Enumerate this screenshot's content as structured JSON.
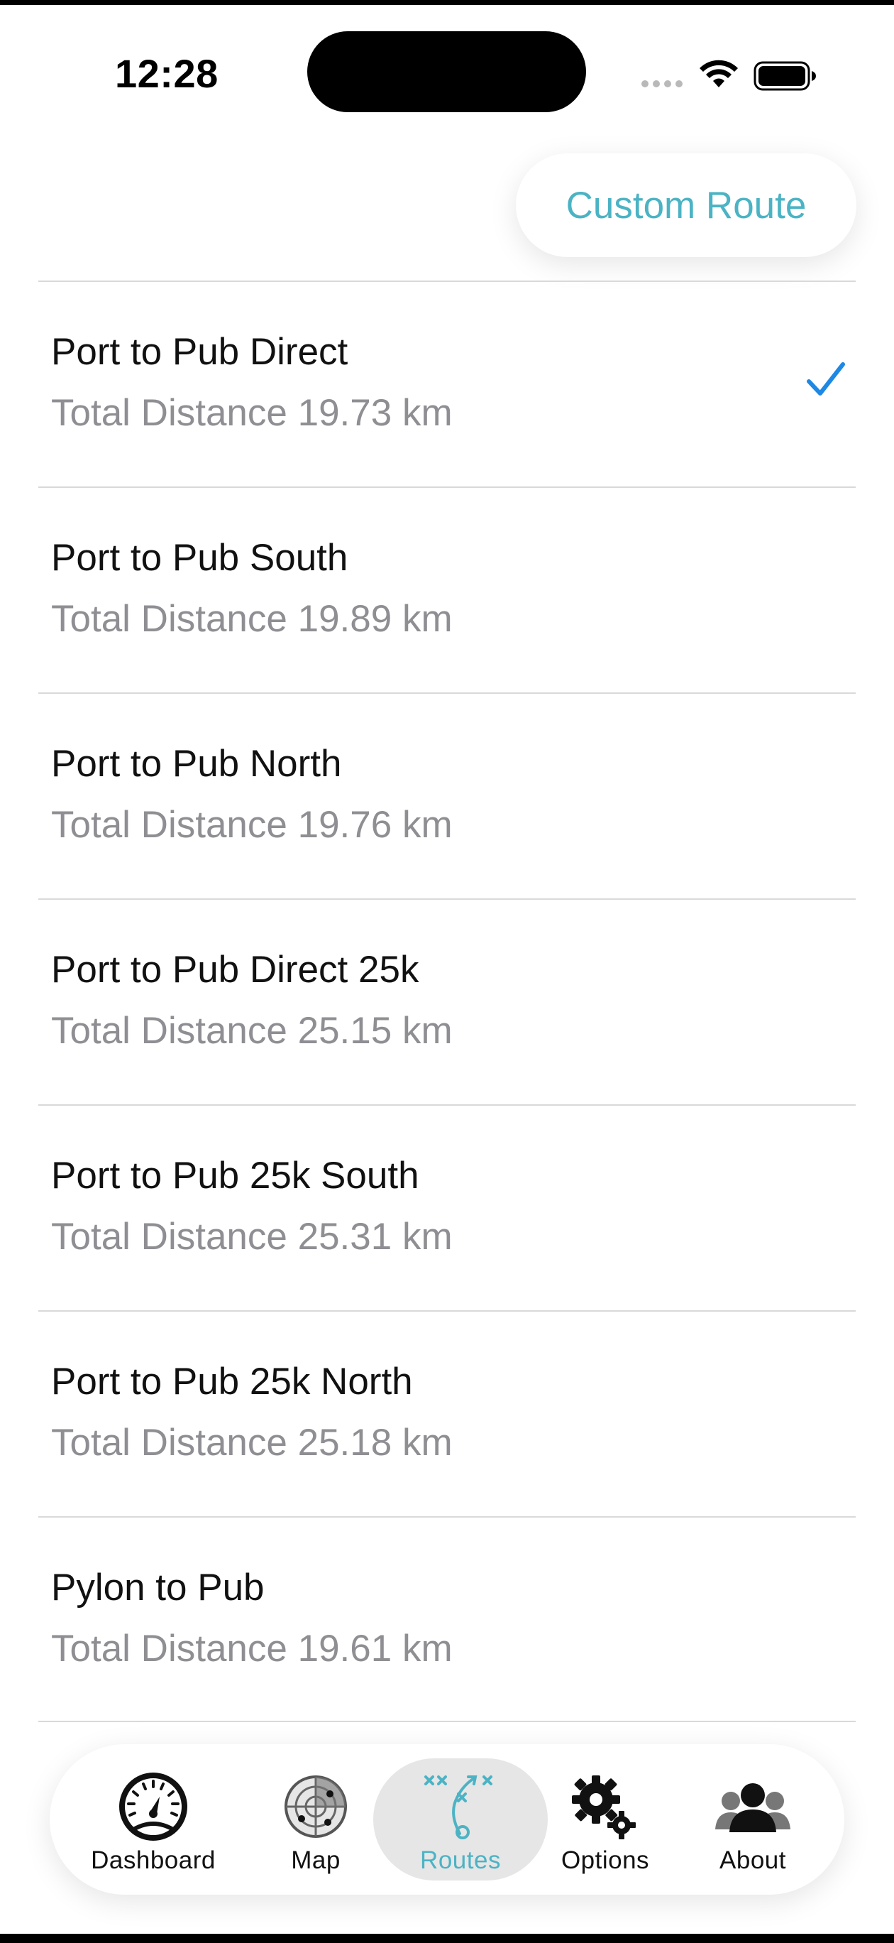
{
  "status_bar": {
    "time": "12:28"
  },
  "header": {
    "custom_route_label": "Custom Route"
  },
  "colors": {
    "accent": "#4bb3c4",
    "check": "#1e88e5",
    "secondary_text": "#8e8e93",
    "separator": "#d9d9d9"
  },
  "routes": [
    {
      "name": "Port to Pub Direct",
      "distance": "Total Distance 19.73 km",
      "selected": true
    },
    {
      "name": "Port to Pub South",
      "distance": "Total Distance 19.89 km",
      "selected": false
    },
    {
      "name": "Port to Pub North",
      "distance": "Total Distance 19.76 km",
      "selected": false
    },
    {
      "name": "Port to Pub Direct 25k",
      "distance": "Total Distance 25.15 km",
      "selected": false
    },
    {
      "name": "Port to Pub 25k South",
      "distance": "Total Distance 25.31 km",
      "selected": false
    },
    {
      "name": "Port to Pub 25k North",
      "distance": "Total Distance 25.18 km",
      "selected": false
    },
    {
      "name": "Pylon to Pub",
      "distance": "Total Distance 19.61 km",
      "selected": false
    }
  ],
  "tabs": [
    {
      "label": "Dashboard",
      "icon": "speedometer-icon",
      "active": false
    },
    {
      "label": "Map",
      "icon": "radar-icon",
      "active": false
    },
    {
      "label": "Routes",
      "icon": "play-diagram-icon",
      "active": true
    },
    {
      "label": "Options",
      "icon": "gears-icon",
      "active": false
    },
    {
      "label": "About",
      "icon": "people-icon",
      "active": false
    }
  ]
}
